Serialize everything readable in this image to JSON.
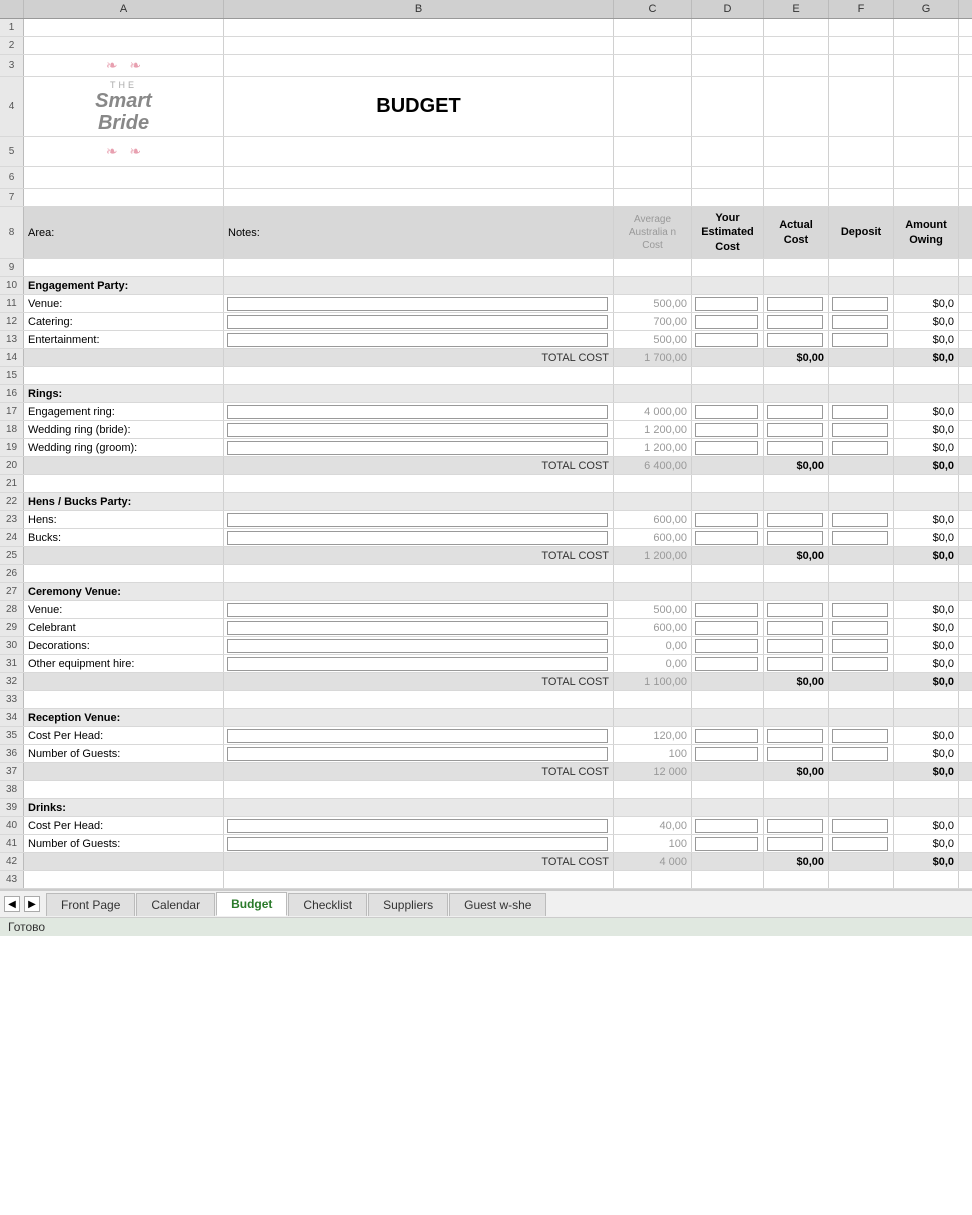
{
  "title": "BUDGET",
  "logo": {
    "the": "THE",
    "smart": "Smart",
    "bride": "Bride"
  },
  "columns": {
    "a_label": "A",
    "b_label": "B",
    "c_label": "C",
    "d_label": "D",
    "e_label": "E",
    "f_label": "F",
    "g_label": "G"
  },
  "header": {
    "row_num": "8",
    "area_label": "Area:",
    "notes_label": "Notes:",
    "avg_cost_label": "Average Australia n Cost",
    "est_cost_label": "Your Estimated Cost",
    "actual_cost_label": "Actual Cost",
    "deposit_label": "Deposit",
    "amount_owing_label": "Amount Owing"
  },
  "sections": [
    {
      "id": "engagement",
      "header_row": 10,
      "header_label": "Engagement Party:",
      "items": [
        {
          "row": 11,
          "label": "Venue:",
          "avg_cost": "500,00",
          "amount_owing": "$0,0"
        },
        {
          "row": 12,
          "label": "Catering:",
          "avg_cost": "700,00",
          "amount_owing": "$0,0"
        },
        {
          "row": 13,
          "label": "Entertainment:",
          "avg_cost": "500,00",
          "amount_owing": "$0,0"
        }
      ],
      "total_row": 14,
      "total_label": "TOTAL COST",
      "total_avg": "1 700,00",
      "total_actual": "$0,00",
      "total_owing": "$0,0"
    },
    {
      "id": "rings",
      "header_row": 16,
      "header_label": "Rings:",
      "items": [
        {
          "row": 17,
          "label": "Engagement ring:",
          "avg_cost": "4 000,00",
          "amount_owing": "$0,0"
        },
        {
          "row": 18,
          "label": "Wedding ring (bride):",
          "avg_cost": "1 200,00",
          "amount_owing": "$0,0"
        },
        {
          "row": 19,
          "label": "Wedding ring (groom):",
          "avg_cost": "1 200,00",
          "amount_owing": "$0,0"
        }
      ],
      "total_row": 20,
      "total_label": "TOTAL COST",
      "total_avg": "6 400,00",
      "total_actual": "$0,00",
      "total_owing": "$0,0"
    },
    {
      "id": "hens",
      "header_row": 22,
      "header_label": "Hens / Bucks Party:",
      "items": [
        {
          "row": 23,
          "label": "Hens:",
          "avg_cost": "600,00",
          "amount_owing": "$0,0"
        },
        {
          "row": 24,
          "label": "Bucks:",
          "avg_cost": "600,00",
          "amount_owing": "$0,0"
        }
      ],
      "total_row": 25,
      "total_label": "TOTAL COST",
      "total_avg": "1 200,00",
      "total_actual": "$0,00",
      "total_owing": "$0,0"
    },
    {
      "id": "ceremony",
      "header_row": 27,
      "header_label": "Ceremony Venue:",
      "items": [
        {
          "row": 28,
          "label": "Venue:",
          "avg_cost": "500,00",
          "amount_owing": "$0,0"
        },
        {
          "row": 29,
          "label": "Celebrant",
          "avg_cost": "600,00",
          "amount_owing": "$0,0"
        },
        {
          "row": 30,
          "label": "Decorations:",
          "avg_cost": "0,00",
          "amount_owing": "$0,0"
        },
        {
          "row": 31,
          "label": "Other equipment hire:",
          "avg_cost": "0,00",
          "amount_owing": "$0,0"
        }
      ],
      "total_row": 32,
      "total_label": "TOTAL COST",
      "total_avg": "1 100,00",
      "total_actual": "$0,00",
      "total_owing": "$0,0"
    },
    {
      "id": "reception",
      "header_row": 34,
      "header_label": "Reception Venue:",
      "items": [
        {
          "row": 35,
          "label": "Cost Per Head:",
          "avg_cost": "120,00",
          "amount_owing": "$0,0"
        },
        {
          "row": 36,
          "label": "Number of Guests:",
          "avg_cost": "100",
          "amount_owing": "$0,0"
        }
      ],
      "total_row": 37,
      "total_label": "TOTAL COST",
      "total_avg": "12 000",
      "total_actual": "$0,00",
      "total_owing": "$0,0"
    },
    {
      "id": "drinks",
      "header_row": 39,
      "header_label": "Drinks:",
      "items": [
        {
          "row": 40,
          "label": "Cost Per Head:",
          "avg_cost": "40,00",
          "amount_owing": "$0,0"
        },
        {
          "row": 41,
          "label": "Number of Guests:",
          "avg_cost": "100",
          "amount_owing": "$0,0"
        }
      ],
      "total_row": 42,
      "total_label": "TOTAL COST",
      "total_avg": "4 000",
      "total_actual": "$0,00",
      "total_owing": "$0,0"
    }
  ],
  "tabs": [
    {
      "id": "front-page",
      "label": "Front Page",
      "active": false
    },
    {
      "id": "calendar",
      "label": "Calendar",
      "active": false
    },
    {
      "id": "budget",
      "label": "Budget",
      "active": true
    },
    {
      "id": "checklist",
      "label": "Checklist",
      "active": false
    },
    {
      "id": "suppliers",
      "label": "Suppliers",
      "active": false
    },
    {
      "id": "guest-w-she",
      "label": "Guest w-she",
      "active": false
    }
  ],
  "status_bar": "Готово",
  "row_numbers": [
    "1",
    "2",
    "3",
    "4",
    "5",
    "6",
    "7",
    "8",
    "9",
    "10",
    "11",
    "12",
    "13",
    "14",
    "15",
    "16",
    "17",
    "18",
    "19",
    "20",
    "21",
    "22",
    "23",
    "24",
    "25",
    "26",
    "27",
    "28",
    "29",
    "30",
    "31",
    "32",
    "33",
    "34",
    "35",
    "36",
    "37",
    "38",
    "39",
    "40",
    "41",
    "42",
    "43"
  ]
}
